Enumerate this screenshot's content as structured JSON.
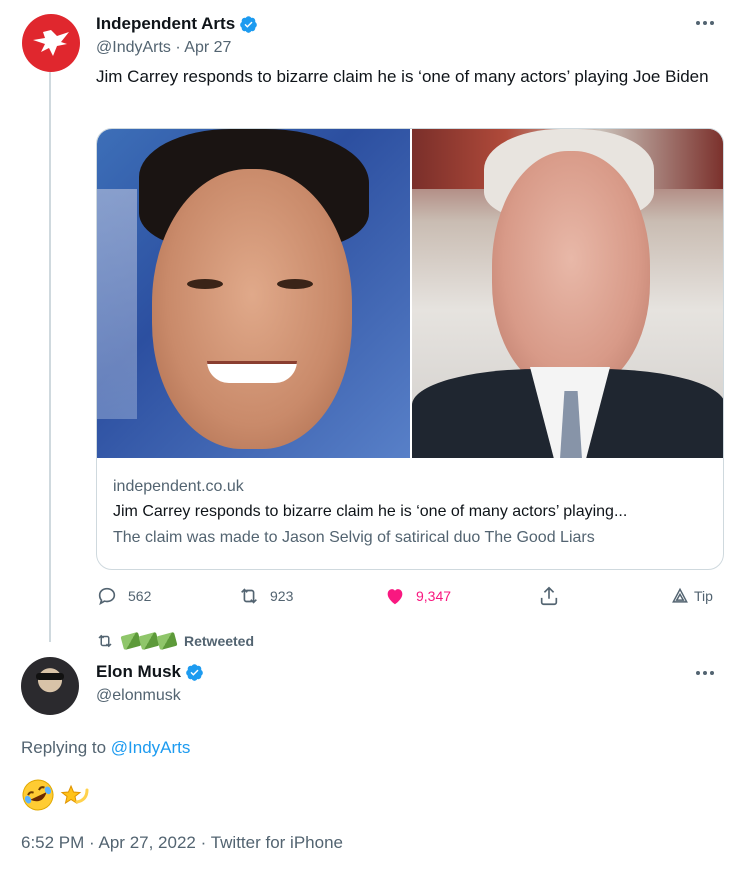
{
  "tweet": {
    "author_name": "Independent Arts",
    "author_handle": "@IndyArts",
    "separator": "·",
    "date": "Apr 27",
    "text": "Jim Carrey responds to bizarre claim he is ‘one of many actors’ playing Joe Biden",
    "card": {
      "domain": "independent.co.uk",
      "title": "Jim Carrey responds to bizarre claim he is ‘one of many actors’ playing...",
      "description": "The claim was made to Jason Selvig of satirical duo The Good Liars"
    },
    "actions": {
      "replies": "562",
      "retweets": "923",
      "likes": "9,347",
      "tip_label": "Tip"
    }
  },
  "retweet_row": {
    "label": "Retweeted"
  },
  "reply": {
    "author_name": "Elon Musk",
    "author_handle": "@elonmusk",
    "replying_prefix": "Replying to",
    "replying_to": "@IndyArts",
    "emojis": [
      "rolling-on-floor-laughing",
      "dizzy-star"
    ],
    "time": "6:52 PM",
    "date": "Apr 27, 2022",
    "source": "Twitter for iPhone",
    "separator": "·"
  },
  "colors": {
    "brand_blue": "#1d9bf0",
    "like_pink": "#f91880",
    "muted": "#536471",
    "indy_red": "#e0272e"
  }
}
